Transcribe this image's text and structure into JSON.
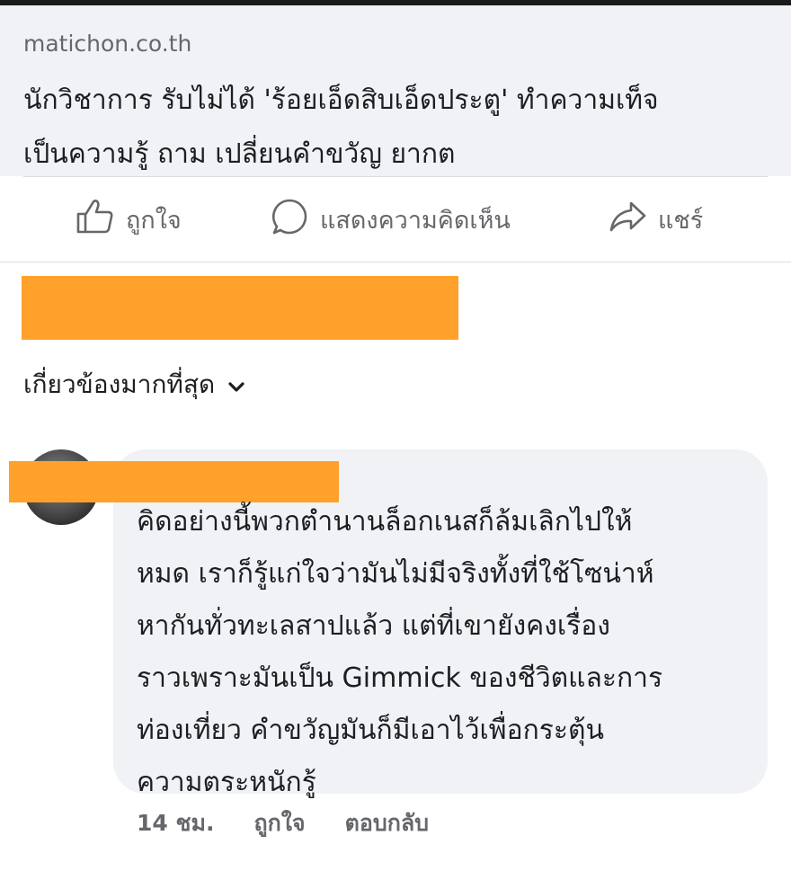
{
  "link_preview": {
    "domain": "matichon.co.th",
    "headline_line1": "นักวิชาการ รับไม่ได้ 'ร้อยเอ็ดสิบเอ็ดประตู' ทำความเท็จ",
    "headline_line2": "เป็นความรู้ ถาม เปลี่ยนคำขวัญ ยากต"
  },
  "actions": {
    "like_label": "ถูกใจ",
    "comment_label": "แสดงความคิดเห็น",
    "share_label": "แชร์"
  },
  "sort": {
    "label": "เกี่ยวข้องมากที่สุด"
  },
  "comment": {
    "lines": [
      "คิดอย่างนี้พวกตำนานล็อกเนสก็ล้มเลิกไปให้",
      "หมด เราก็รู้แก่ใจว่ามันไม่มีจริงทั้งที่ใช้โซน่าห์",
      "หากันทั่วทะเลสาปแล้ว แต่ที่เขายังคงเรื่อง",
      "ราวเพราะมันเป็น Gimmick ของชีวิตและการ",
      "ท่องเที่ยว คำขวัญมันก็มีเอาไว้เพื่อกระตุ้น",
      "ความตระหนักรู้"
    ],
    "time": "14 ชม.",
    "like_label": "ถูกใจ",
    "reply_label": "ตอบกลับ"
  },
  "colors": {
    "redaction": "#ffa12b",
    "bubble": "#f0f2f5",
    "muted": "#65676b"
  }
}
